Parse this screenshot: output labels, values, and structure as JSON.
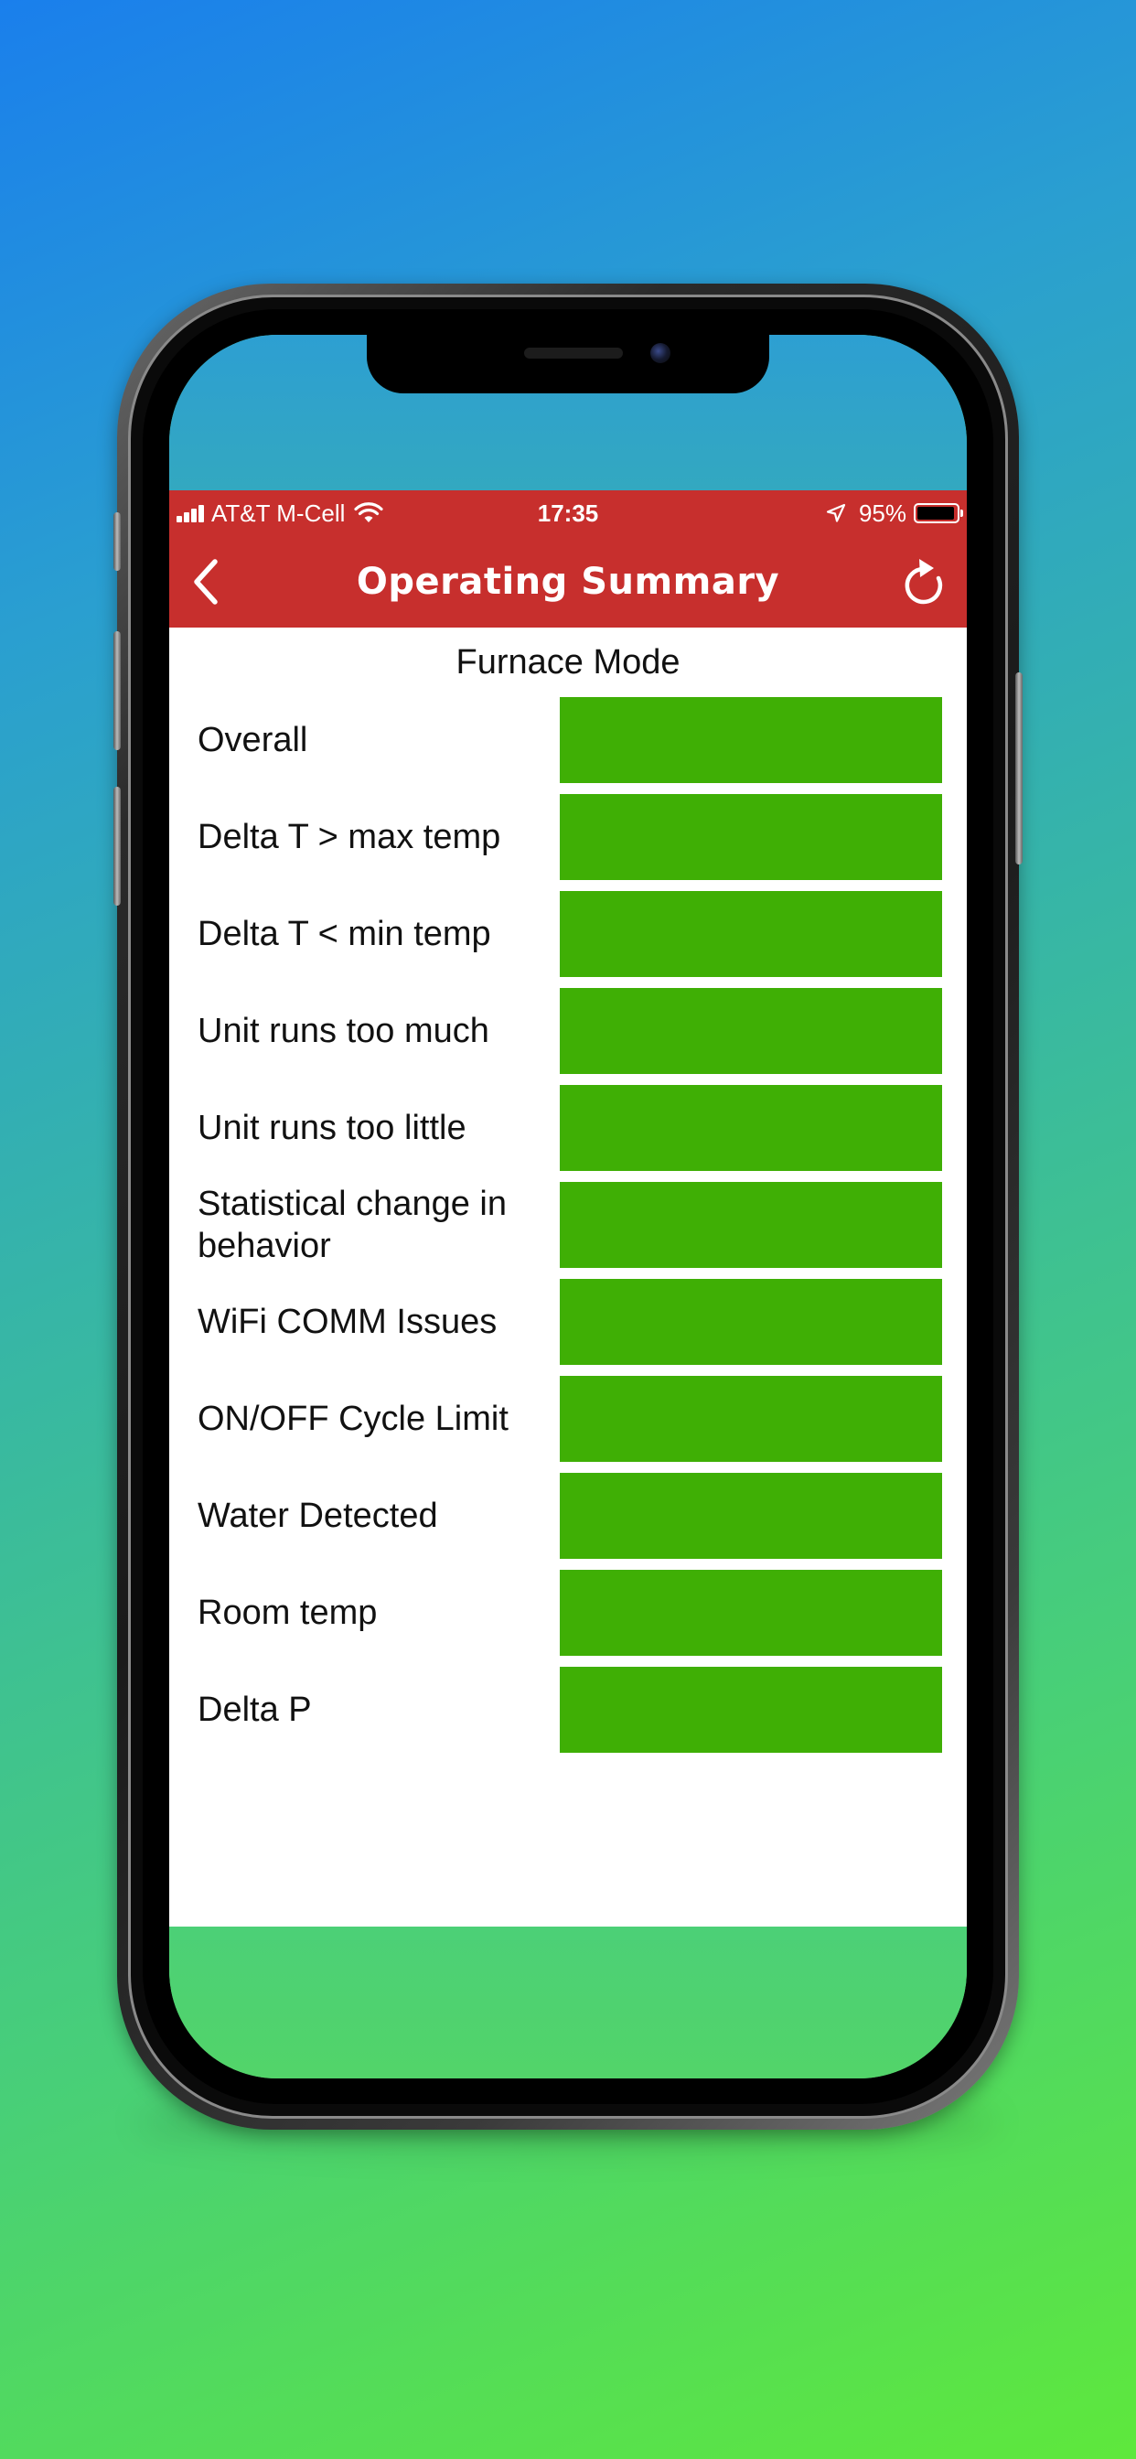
{
  "status_bar": {
    "carrier": "AT&T M-Cell",
    "time": "17:35",
    "battery_percent_label": "95%",
    "battery_level": 0.95
  },
  "nav": {
    "title": "Operating Summary",
    "back_icon": "chevron-left-icon",
    "refresh_icon": "refresh-icon"
  },
  "mode_title": "Furnace Mode",
  "colors": {
    "header": "#c72f2d",
    "status_ok": "#3faf05"
  },
  "rows": [
    {
      "label": "Overall",
      "status": "ok"
    },
    {
      "label": "Delta T > max temp",
      "status": "ok"
    },
    {
      "label": "Delta T  < min temp",
      "status": "ok"
    },
    {
      "label": "Unit runs too much",
      "status": "ok"
    },
    {
      "label": "Unit runs too little",
      "status": "ok"
    },
    {
      "label": "Statistical change in behavior",
      "status": "ok"
    },
    {
      "label": "WiFi COMM Issues",
      "status": "ok"
    },
    {
      "label": "ON/OFF Cycle Limit",
      "status": "ok"
    },
    {
      "label": "Water Detected",
      "status": "ok"
    },
    {
      "label": "Room temp",
      "status": "ok"
    },
    {
      "label": "Delta P",
      "status": "ok"
    }
  ]
}
